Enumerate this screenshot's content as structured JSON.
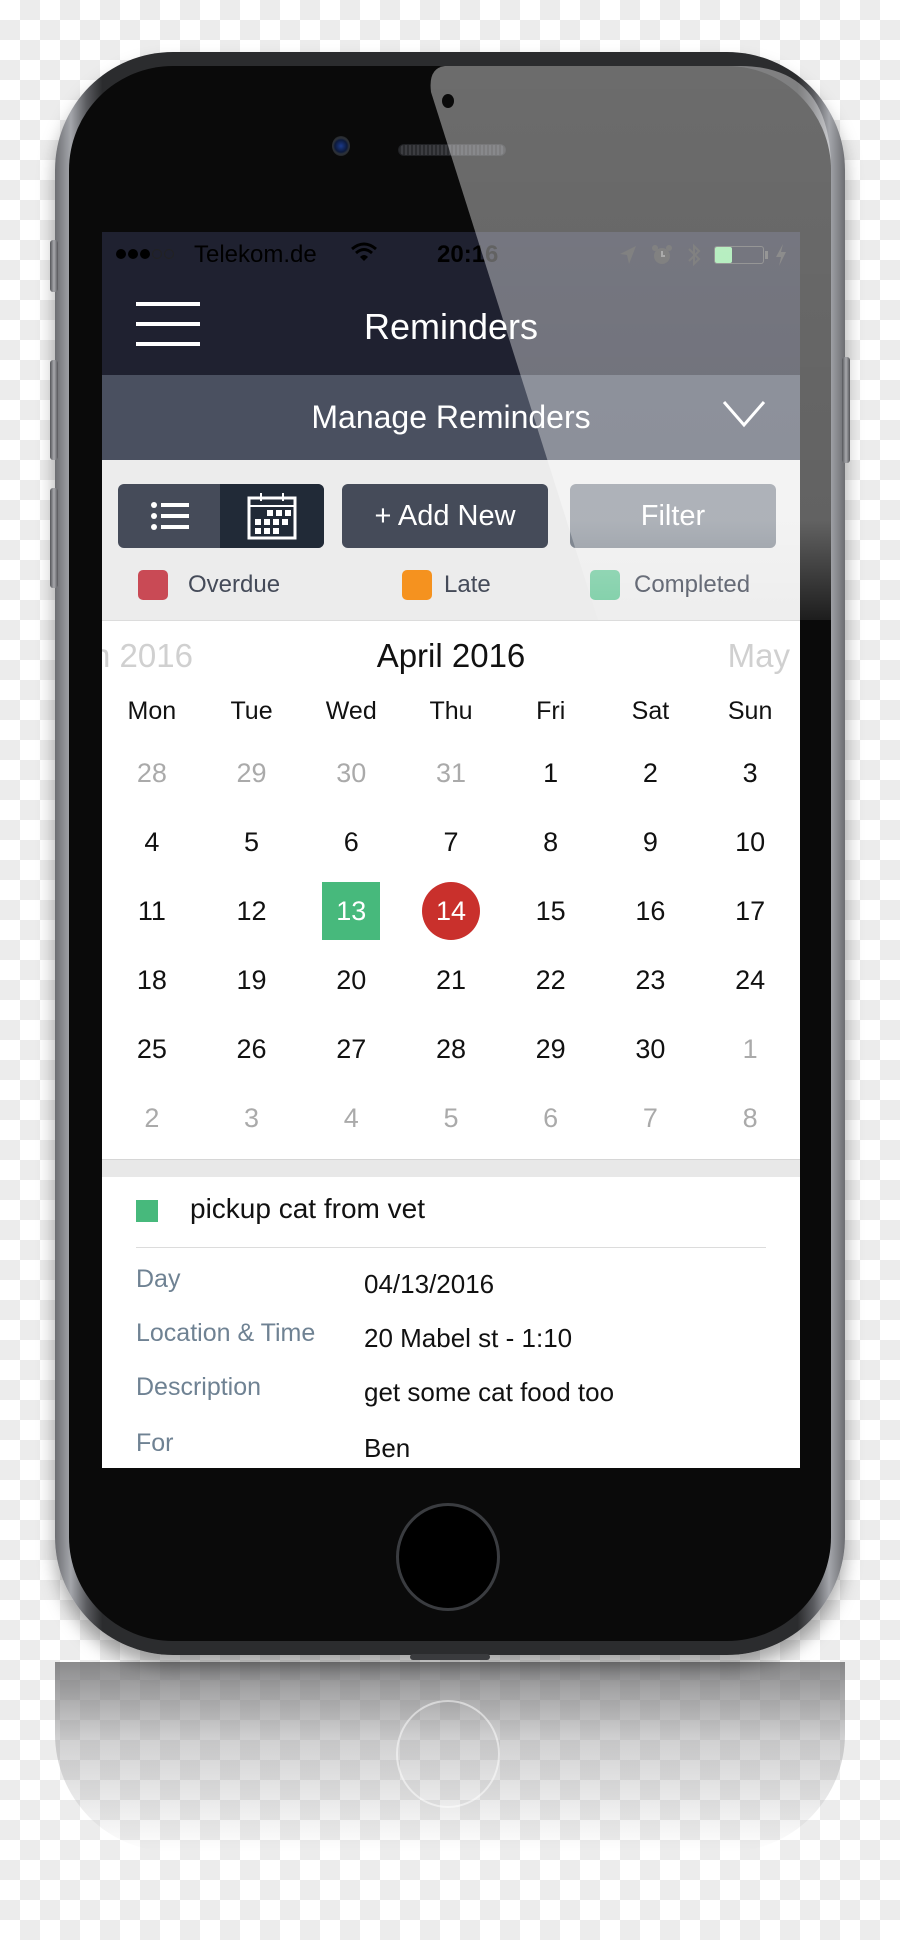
{
  "status_bar": {
    "signal_filled": 3,
    "signal_empty": 2,
    "carrier": "Telekom.de",
    "time": "20:16",
    "icons": [
      "wifi-icon",
      "location-arrow-icon",
      "alarm-icon",
      "bluetooth-icon",
      "battery-icon",
      "charging-bolt-icon"
    ],
    "battery_level": 0.35,
    "battery_color": "#8be39a"
  },
  "header": {
    "title": "Reminders",
    "menu_icon": "hamburger-menu-icon"
  },
  "manage_bar": {
    "title": "Manage Reminders",
    "icon": "chevron-down-icon"
  },
  "toolbar": {
    "view_toggle": {
      "options": [
        {
          "name": "list",
          "icon": "list-icon",
          "selected": false
        },
        {
          "name": "calendar",
          "icon": "calendar-icon",
          "selected": true
        }
      ]
    },
    "add_new_label": "+ Add New",
    "filter_label": "Filter"
  },
  "legend": [
    {
      "label": "Overdue",
      "color": "#c94a55"
    },
    {
      "label": "Late",
      "color": "#f5921f"
    },
    {
      "label": "Completed",
      "color": "#72ca9f"
    }
  ],
  "calendar": {
    "prev_month": "n 2016",
    "current_month": "April 2016",
    "next_month": "May",
    "weekdays": [
      "Mon",
      "Tue",
      "Wed",
      "Thu",
      "Fri",
      "Sat",
      "Sun"
    ],
    "weeks": [
      [
        {
          "d": "28",
          "muted": true
        },
        {
          "d": "29",
          "muted": true
        },
        {
          "d": "30",
          "muted": true
        },
        {
          "d": "31",
          "muted": true
        },
        {
          "d": "1"
        },
        {
          "d": "2"
        },
        {
          "d": "3"
        }
      ],
      [
        {
          "d": "4"
        },
        {
          "d": "5"
        },
        {
          "d": "6"
        },
        {
          "d": "7"
        },
        {
          "d": "8"
        },
        {
          "d": "9"
        },
        {
          "d": "10"
        }
      ],
      [
        {
          "d": "11"
        },
        {
          "d": "12"
        },
        {
          "d": "13",
          "status": "completed"
        },
        {
          "d": "14",
          "status": "overdue"
        },
        {
          "d": "15"
        },
        {
          "d": "16"
        },
        {
          "d": "17"
        }
      ],
      [
        {
          "d": "18"
        },
        {
          "d": "19"
        },
        {
          "d": "20"
        },
        {
          "d": "21"
        },
        {
          "d": "22"
        },
        {
          "d": "23"
        },
        {
          "d": "24"
        }
      ],
      [
        {
          "d": "25"
        },
        {
          "d": "26"
        },
        {
          "d": "27"
        },
        {
          "d": "28"
        },
        {
          "d": "29"
        },
        {
          "d": "30"
        },
        {
          "d": "1",
          "muted": true
        }
      ],
      [
        {
          "d": "2",
          "muted": true
        },
        {
          "d": "3",
          "muted": true
        },
        {
          "d": "4",
          "muted": true
        },
        {
          "d": "5",
          "muted": true
        },
        {
          "d": "6",
          "muted": true
        },
        {
          "d": "7",
          "muted": true
        },
        {
          "d": "8",
          "muted": true
        }
      ]
    ],
    "status_colors": {
      "completed": "#47b97c",
      "overdue": "#c9302c"
    }
  },
  "reminder": {
    "title": "pickup cat from vet",
    "status": "completed",
    "fields": [
      {
        "label": "Day",
        "value": "04/13/2016"
      },
      {
        "label": "Location & Time",
        "value": "20 Mabel st - 1:10"
      },
      {
        "label": "Description",
        "value": "get some cat food too"
      },
      {
        "label": "For",
        "value": "Ben"
      }
    ]
  }
}
